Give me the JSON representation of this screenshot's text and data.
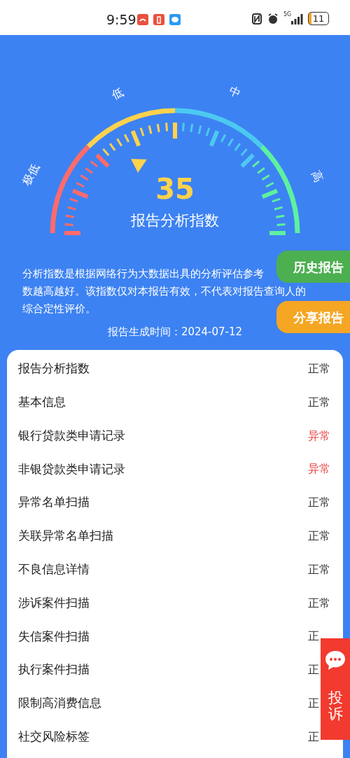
{
  "status_bar": {
    "time": "9:59",
    "network": "5G",
    "battery": "11"
  },
  "gauge": {
    "level": 0.35,
    "score": "35",
    "label": "报告分析指数",
    "bands": [
      {
        "label": "极低",
        "color": "#ff6b6b"
      },
      {
        "label": "低",
        "color": "#ffd24d"
      },
      {
        "label": "中",
        "color": "#4cc9f0"
      },
      {
        "label": "高",
        "color": "#5ef0a0"
      }
    ]
  },
  "description": {
    "lines": [
      "分析指数是根据网络行为大数据出具的分析评估参考",
      "数越高越好。该指数仅对本报告有效，不代表对报告查询人的",
      "综合定性评价。"
    ]
  },
  "generated": "报告生成时间：2024-07-12",
  "side_buttons": [
    {
      "label": "历史报告",
      "color": "#4caf50"
    },
    {
      "label": "分享报告",
      "color": "#f5a623"
    }
  ],
  "items": [
    {
      "name": "报告分析指数",
      "status": "正常",
      "alert": false
    },
    {
      "name": "基本信息",
      "status": "正常",
      "alert": false
    },
    {
      "name": "银行贷款类申请记录",
      "status": "异常",
      "alert": true
    },
    {
      "name": "非银贷款类申请记录",
      "status": "异常",
      "alert": true
    },
    {
      "name": "异常名单扫描",
      "status": "正常",
      "alert": false
    },
    {
      "name": "关联异常名单扫描",
      "status": "正常",
      "alert": false
    },
    {
      "name": "不良信息详情",
      "status": "正常",
      "alert": false
    },
    {
      "name": "涉诉案件扫描",
      "status": "正常",
      "alert": false
    },
    {
      "name": "失信案件扫描",
      "status": "正",
      "alert": false
    },
    {
      "name": "执行案件扫描",
      "status": "正",
      "alert": false
    },
    {
      "name": "限制高消费信息",
      "status": "正",
      "alert": false
    },
    {
      "name": "社交风险标签",
      "status": "正",
      "alert": false
    }
  ],
  "complaint_button": {
    "label": "投诉"
  }
}
